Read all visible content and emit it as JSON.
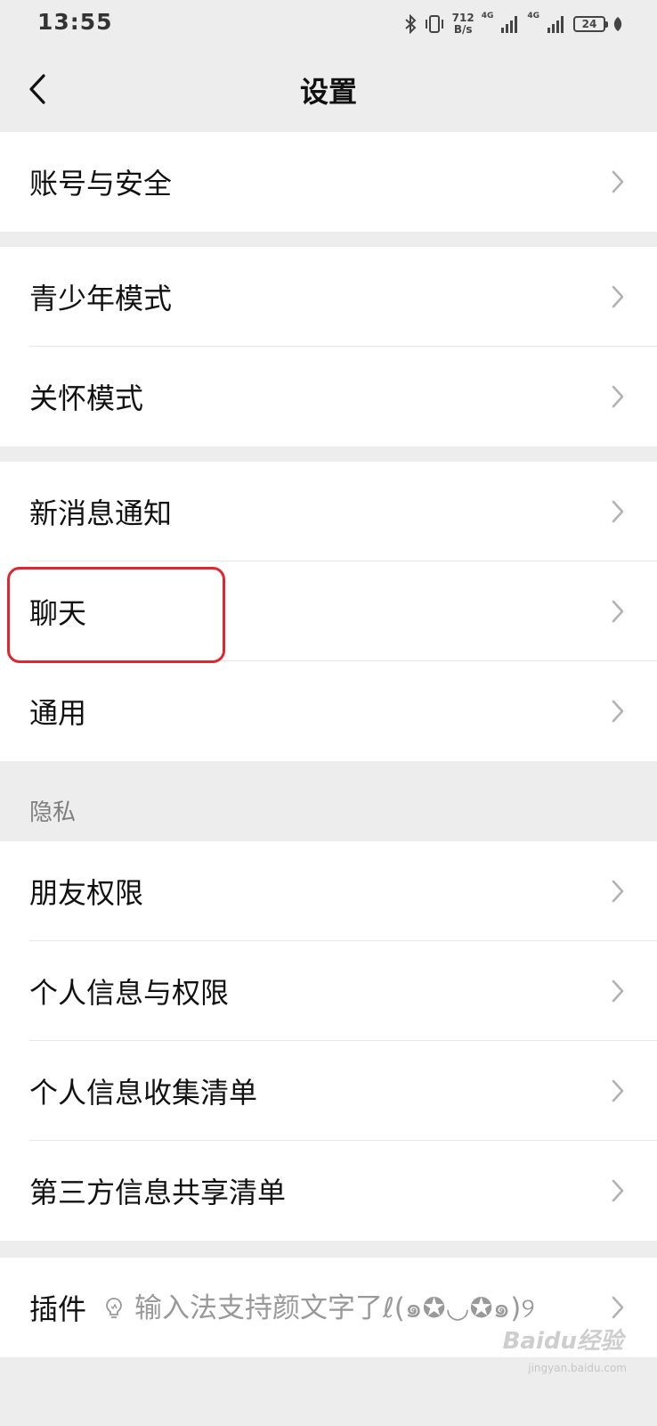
{
  "status_bar": {
    "time": "13:55",
    "net_speed_value": "712",
    "net_speed_unit": "B/s",
    "signal_1_label": "4G",
    "signal_2_label": "4G",
    "battery_level": "24"
  },
  "nav": {
    "title": "设置"
  },
  "groups": {
    "account": [
      {
        "label": "账号与安全"
      }
    ],
    "modes": [
      {
        "label": "青少年模式"
      },
      {
        "label": "关怀模式"
      }
    ],
    "general": [
      {
        "label": "新消息通知"
      },
      {
        "label": "聊天"
      },
      {
        "label": "通用"
      }
    ],
    "privacy": {
      "header": "隐私",
      "items": [
        {
          "label": "朋友权限"
        },
        {
          "label": "个人信息与权限"
        },
        {
          "label": "个人信息收集清单"
        },
        {
          "label": "第三方信息共享清单"
        }
      ]
    },
    "plugins": [
      {
        "label": "插件",
        "extra": "输入法支持颜文字了ℓ(๑✪◡✪๑)୨"
      }
    ]
  },
  "watermark": {
    "brand": "Baidu经验",
    "url": "jingyan.baidu.com"
  },
  "colors": {
    "background": "#ededed",
    "highlight": "#e02631"
  }
}
